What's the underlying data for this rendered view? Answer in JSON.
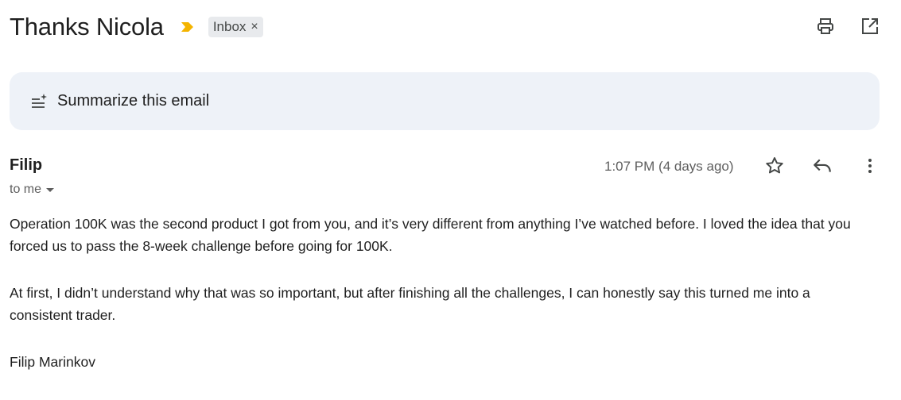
{
  "subject": "Thanks Nicola",
  "label_chip": {
    "label": "Inbox",
    "remove": "×"
  },
  "icons": {
    "importance": "importance-marker-icon",
    "print": "print-icon",
    "open_new_window": "open-in-new-window-icon",
    "summarize": "summarize-sparkle-icon",
    "star": "star-icon",
    "reply": "reply-icon",
    "more": "more-vert-icon"
  },
  "colors": {
    "importance": "#f4b400",
    "summary_bg": "#eef2f8",
    "chip_bg": "#e8eaed"
  },
  "summary_button": "Summarize this email",
  "message": {
    "sender": "Filip",
    "recipient": "to me",
    "timestamp": "1:07 PM (4 days ago)",
    "paragraphs": [
      "Operation 100K was the second product I got from you, and it’s very different from anything I’ve watched before. I loved the idea that you forced us to pass the 8-week challenge before going for 100K.",
      "At first, I didn’t understand why that was so important, but after finishing all the challenges, I can honestly say this turned me into a consistent trader."
    ],
    "signature": "Filip Marinkov"
  }
}
